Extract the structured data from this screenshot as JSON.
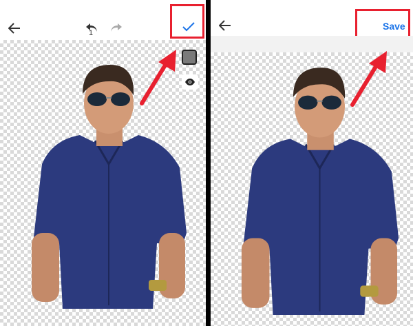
{
  "left_screen": {
    "toolbar": {
      "back_icon": "arrow-left-icon",
      "undo_icon": "undo-icon",
      "undo_count": "1",
      "redo_icon": "redo-icon",
      "confirm_icon": "check-icon"
    },
    "side_tools": {
      "background_color_icon": "color-swatch-icon",
      "preview_icon": "eye-icon"
    },
    "canvas": {
      "background": "transparent-checkerboard",
      "subject": "cut-out-person-photo"
    }
  },
  "right_screen": {
    "toolbar": {
      "back_icon": "arrow-left-icon",
      "save_label": "Save"
    },
    "canvas": {
      "background": "transparent-checkerboard",
      "subject": "cut-out-person-photo"
    }
  },
  "colors": {
    "highlight": "#e8202f",
    "accent_blue": "#1a73e8",
    "shirt_blue": "#2c3a7e",
    "checker_gray": "#d9d9d9",
    "divider": "#000000"
  }
}
